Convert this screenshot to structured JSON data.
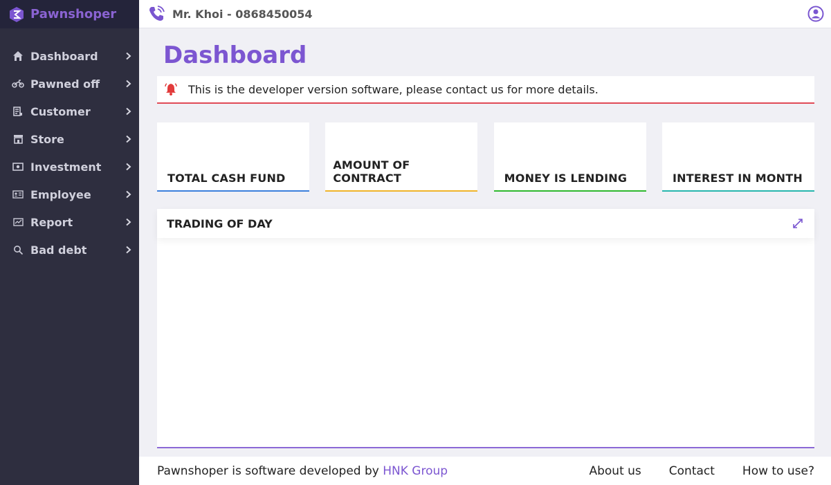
{
  "brand": {
    "name": "Pawnshoper"
  },
  "topbar": {
    "user": "Mr. Khoi - 0868450054"
  },
  "sidebar": {
    "items": [
      {
        "label": "Dashboard",
        "icon": "home-icon"
      },
      {
        "label": "Pawned off",
        "icon": "motorbike-icon"
      },
      {
        "label": "Customer",
        "icon": "customer-icon"
      },
      {
        "label": "Store",
        "icon": "store-icon"
      },
      {
        "label": "Investment",
        "icon": "investment-icon"
      },
      {
        "label": "Employee",
        "icon": "employee-icon"
      },
      {
        "label": "Report",
        "icon": "report-icon"
      },
      {
        "label": "Bad debt",
        "icon": "search-icon"
      }
    ]
  },
  "main": {
    "title": "Dashboard",
    "notice": "This is the developer version software, please contact us for more details.",
    "cards": [
      {
        "label": "TOTAL CASH FUND",
        "color": "#3b7fdc"
      },
      {
        "label": "AMOUNT OF CONTRACT",
        "color": "#f0b429"
      },
      {
        "label": "MONEY IS LENDING",
        "color": "#2eb82e"
      },
      {
        "label": "INTEREST IN MONTH",
        "color": "#27b5ad"
      }
    ],
    "panel": {
      "title": "TRADING OF DAY"
    }
  },
  "footer": {
    "text": "Pawnshoper is software developed by ",
    "company": "HNK Group",
    "links": [
      "About us",
      "Contact",
      "How to use?"
    ]
  },
  "colors": {
    "accent": "#7c56d1",
    "sidebar": "#2e2e3f",
    "alert": "#e04a56"
  }
}
